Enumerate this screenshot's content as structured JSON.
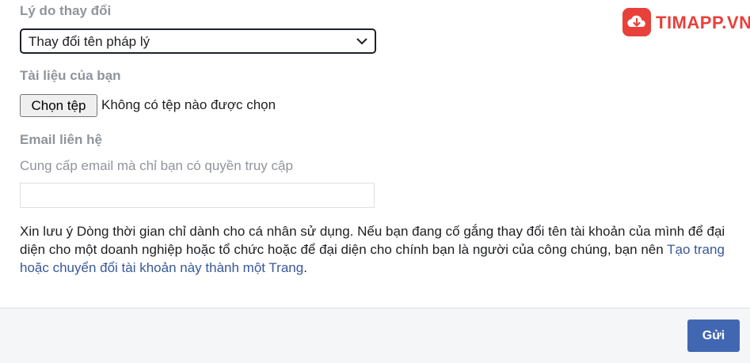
{
  "form": {
    "reason_label": "Lý do thay đổi",
    "reason_selected": "Thay đổi tên pháp lý",
    "documents_label": "Tài liệu của bạn",
    "choose_file_label": "Chọn tệp",
    "file_status": "Không có tệp nào được chọn",
    "email_label": "Email liên hệ",
    "email_hint": "Cung cấp email mà chỉ bạn có quyền truy cập",
    "email_value": ""
  },
  "note": {
    "text_before_link": "Xin lưu ý Dòng thời gian chỉ dành cho cá nhân sử dụng. Nếu bạn đang cố gắng thay đổi tên tài khoản của mình để đại diện cho một doanh nghiệp hoặc tổ chức hoặc để đại diện cho chính bạn là người của công chúng, bạn nên ",
    "link_text": "Tạo trang hoặc chuyển đổi tài khoản này thành một Trang",
    "text_after_link": "."
  },
  "footer": {
    "submit_label": "Gửi"
  },
  "watermark": {
    "brand": "TIMAPP.VN"
  },
  "colors": {
    "accent": "#4267b2",
    "link": "#385898",
    "label_gray": "#90949c",
    "brand_red": "#e8403a"
  }
}
